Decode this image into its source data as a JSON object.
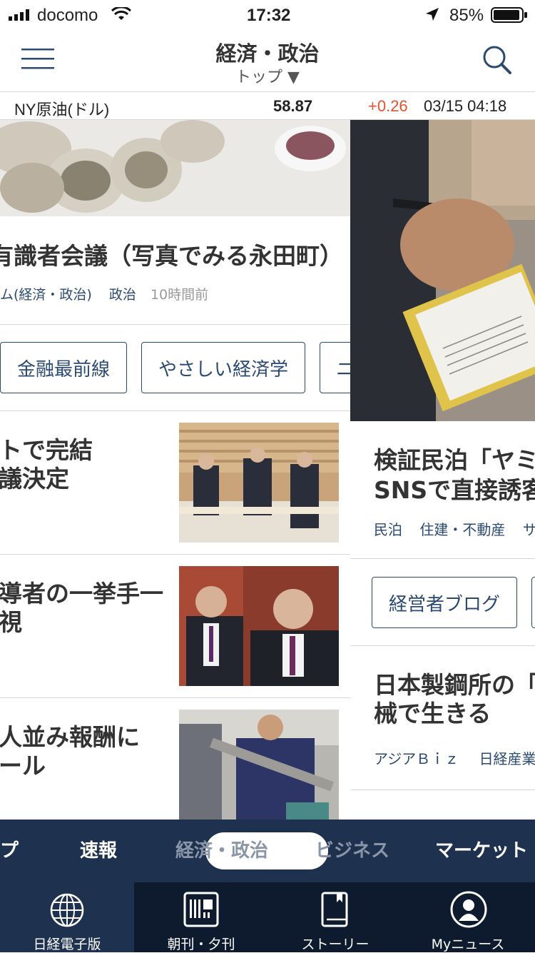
{
  "status": {
    "carrier": "docomo",
    "time": "17:32",
    "battery": "85%"
  },
  "header": {
    "title": "経済・政治",
    "subtitle": "トップ ▼"
  },
  "ticker": {
    "name": "NY原油(ドル)",
    "price": "58.87",
    "change": "+0.26",
    "datetime": "03/15 04:18",
    "change_color": "#e0532f"
  },
  "left": {
    "top_article": {
      "title": "有識者会議（写真でみる永田町）",
      "category": "ム(経済・政治)",
      "tag": "政治",
      "time": "10時間前"
    },
    "chips": [
      "金融最前線",
      "やさしい経済学",
      "ニ"
    ],
    "articles": [
      {
        "line1": "トで完結",
        "line2": "議決定"
      },
      {
        "line1": "導者の一挙手一",
        "line2": "視"
      },
      {
        "line1": "人並み報酬に",
        "line2": "ール"
      }
    ]
  },
  "right": {
    "article1": {
      "line1": "検証民泊「ヤミ",
      "line2": "SNSで直接誘客",
      "tag1": "民泊",
      "tag2": "住建・不動産",
      "tag3": "サ"
    },
    "chips": [
      "経営者ブログ"
    ],
    "article2": {
      "line1": "日本製鋼所の「卒",
      "line2": "械で生きる",
      "tag1": "アジアＢｉｚ",
      "tag2": "日経産業"
    }
  },
  "sections": [
    "プ",
    "速報",
    "経済・政治",
    "ビジネス",
    "マーケット"
  ],
  "tabs": [
    "日経電子版",
    "朝刊・夕刊",
    "ストーリー",
    "Myニュース"
  ],
  "colors": {
    "navy": "#1e3250",
    "tab_bg": "#0e1b2e",
    "accent": "#2b4a72"
  }
}
